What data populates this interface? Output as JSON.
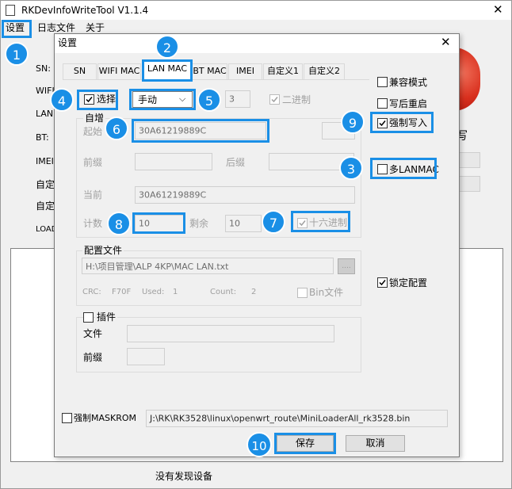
{
  "main": {
    "title": "RKDevInfoWriteTool V1.1.4",
    "menu": [
      "设置",
      "日志文件",
      "关于"
    ],
    "labels": {
      "sn": "SN:",
      "wifi": "WIFI",
      "lan": "LAN:",
      "bt": "BT:",
      "imei": "IMEI",
      "custom1": "自定",
      "custom2": "自定",
      "load": "LOAD"
    },
    "status": "没有发现设备",
    "side_char": "写"
  },
  "dialog": {
    "title": "设置",
    "tabs": [
      "SN",
      "WIFI MAC",
      "LAN MAC",
      "BT MAC",
      "IMEI",
      "自定义1",
      "自定义2"
    ],
    "select_checkbox": "选择",
    "mode_value": "手动",
    "length_value": "3",
    "binary_label": "二进制",
    "compat_mode": "兼容模式",
    "reboot_after_write": "写后重启",
    "force_write": "强制写入",
    "multi_lanmac": "多LANMAC",
    "auto_inc": {
      "group_label": "自增",
      "start_label": "起始",
      "start_value": "30A61219889C",
      "prefix_label": "前缀",
      "suffix_label": "后缀",
      "current_label": "当前",
      "current_value": "30A61219889C",
      "count_label": "计数",
      "count_value": "10",
      "remain_label": "剩余",
      "remain_value": "10",
      "hex_label": "十六进制"
    },
    "config_file": {
      "group_label": "配置文件",
      "path": "H:\\项目管理\\ALP 4KP\\MAC LAN.txt",
      "browse": "....",
      "crc_label": "CRC:",
      "crc_value": "F70F",
      "used_label": "Used:",
      "used_value": "1",
      "count_label": "Count:",
      "count_value": "2",
      "bin_label": "Bin文件"
    },
    "lock_config": "锁定配置",
    "plugin": {
      "group_label": "插件",
      "file_label": "文件",
      "prefix_label": "前缀"
    },
    "force_maskrom": "强制MASKROM",
    "loader_path": "J:\\RK\\RK3528\\linux\\openwrt_route\\MiniLoaderAll_rk3528.bin",
    "save": "保存",
    "cancel": "取消"
  },
  "annotations": [
    "1",
    "2",
    "3",
    "4",
    "5",
    "6",
    "7",
    "8",
    "9",
    "10"
  ],
  "colors": {
    "highlight": "#1a8fe6",
    "red_button": "#d9301e"
  }
}
